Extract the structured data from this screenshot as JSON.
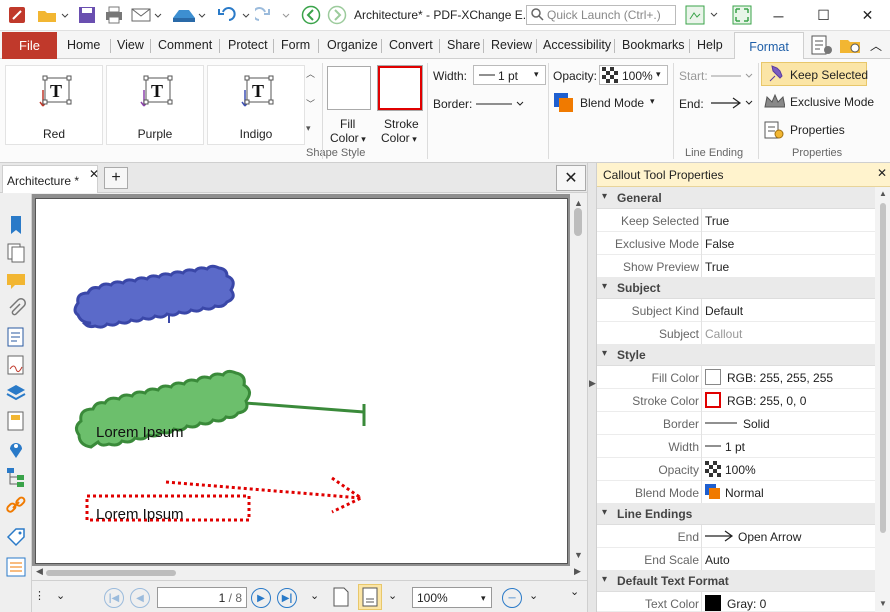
{
  "window": {
    "title": "Architecture* - PDF-XChange E...",
    "quick_launch_placeholder": "Quick Launch (Ctrl+.)"
  },
  "menu": {
    "file": "File",
    "tabs": [
      "Home",
      "View",
      "Comment",
      "Protect",
      "Form",
      "Organize",
      "Convert",
      "Share",
      "Review",
      "Accessibility",
      "Bookmarks",
      "Help"
    ],
    "active_tab": "Format"
  },
  "ribbon": {
    "shape_styles": [
      {
        "label": "Red",
        "color": "#c0392b"
      },
      {
        "label": "Purple",
        "color": "#8e44ad"
      },
      {
        "label": "Indigo",
        "color": "#3f51b5"
      }
    ],
    "shape_style_group": "Shape Style",
    "fill_color_label": [
      "Fill",
      "Color"
    ],
    "stroke_color_label": [
      "Stroke",
      "Color"
    ],
    "fill_color": "#ffffff",
    "stroke_color": "#ff0000",
    "width_label": "Width:",
    "width_value": "1 pt",
    "border_label": "Border:",
    "opacity_label": "Opacity:",
    "opacity_value": "100%",
    "blend_mode_label": "Blend Mode",
    "start_label": "Start:",
    "end_label": "End:",
    "line_ending_group": "Line Ending",
    "keep_selected": "Keep Selected",
    "exclusive_mode": "Exclusive Mode",
    "properties": "Properties",
    "properties_group": "Properties"
  },
  "document": {
    "tab_label": "Architecture *",
    "callouts": [
      {
        "text": "",
        "fill": "#5b6ac9",
        "stroke": "#3a47a8",
        "style": "cloud"
      },
      {
        "text": "Lorem Ipsum",
        "fill": "#6cbf6c",
        "stroke": "#3a8a3a",
        "style": "cloud"
      },
      {
        "text": "Lorem Ipsum",
        "fill": "#ffffff",
        "stroke": "#e00000",
        "style": "dotted"
      }
    ]
  },
  "status": {
    "page_value": "1",
    "page_total": "/ 8",
    "zoom": "100%"
  },
  "panel": {
    "title": "Callout Tool Properties",
    "sections": [
      {
        "name": "General",
        "rows": [
          {
            "key": "Keep Selected",
            "value": "True"
          },
          {
            "key": "Exclusive Mode",
            "value": "False"
          },
          {
            "key": "Show Preview",
            "value": "True"
          }
        ]
      },
      {
        "name": "Subject",
        "rows": [
          {
            "key": "Subject Kind",
            "value": "Default"
          },
          {
            "key": "Subject",
            "value": "Callout"
          }
        ]
      },
      {
        "name": "Style",
        "rows": [
          {
            "key": "Fill Color",
            "value": "RGB: 255, 255, 255"
          },
          {
            "key": "Stroke Color",
            "value": "RGB: 255, 0, 0"
          },
          {
            "key": "Border",
            "value": "Solid"
          },
          {
            "key": "Width",
            "value": "1 pt"
          },
          {
            "key": "Opacity",
            "value": "100%"
          },
          {
            "key": "Blend Mode",
            "value": "Normal"
          }
        ]
      },
      {
        "name": "Line Endings",
        "rows": [
          {
            "key": "End",
            "value": "Open Arrow"
          },
          {
            "key": "End Scale",
            "value": "Auto"
          }
        ]
      },
      {
        "name": "Default Text Format",
        "rows": [
          {
            "key": "Text Color",
            "value": "Gray: 0"
          }
        ]
      }
    ]
  }
}
